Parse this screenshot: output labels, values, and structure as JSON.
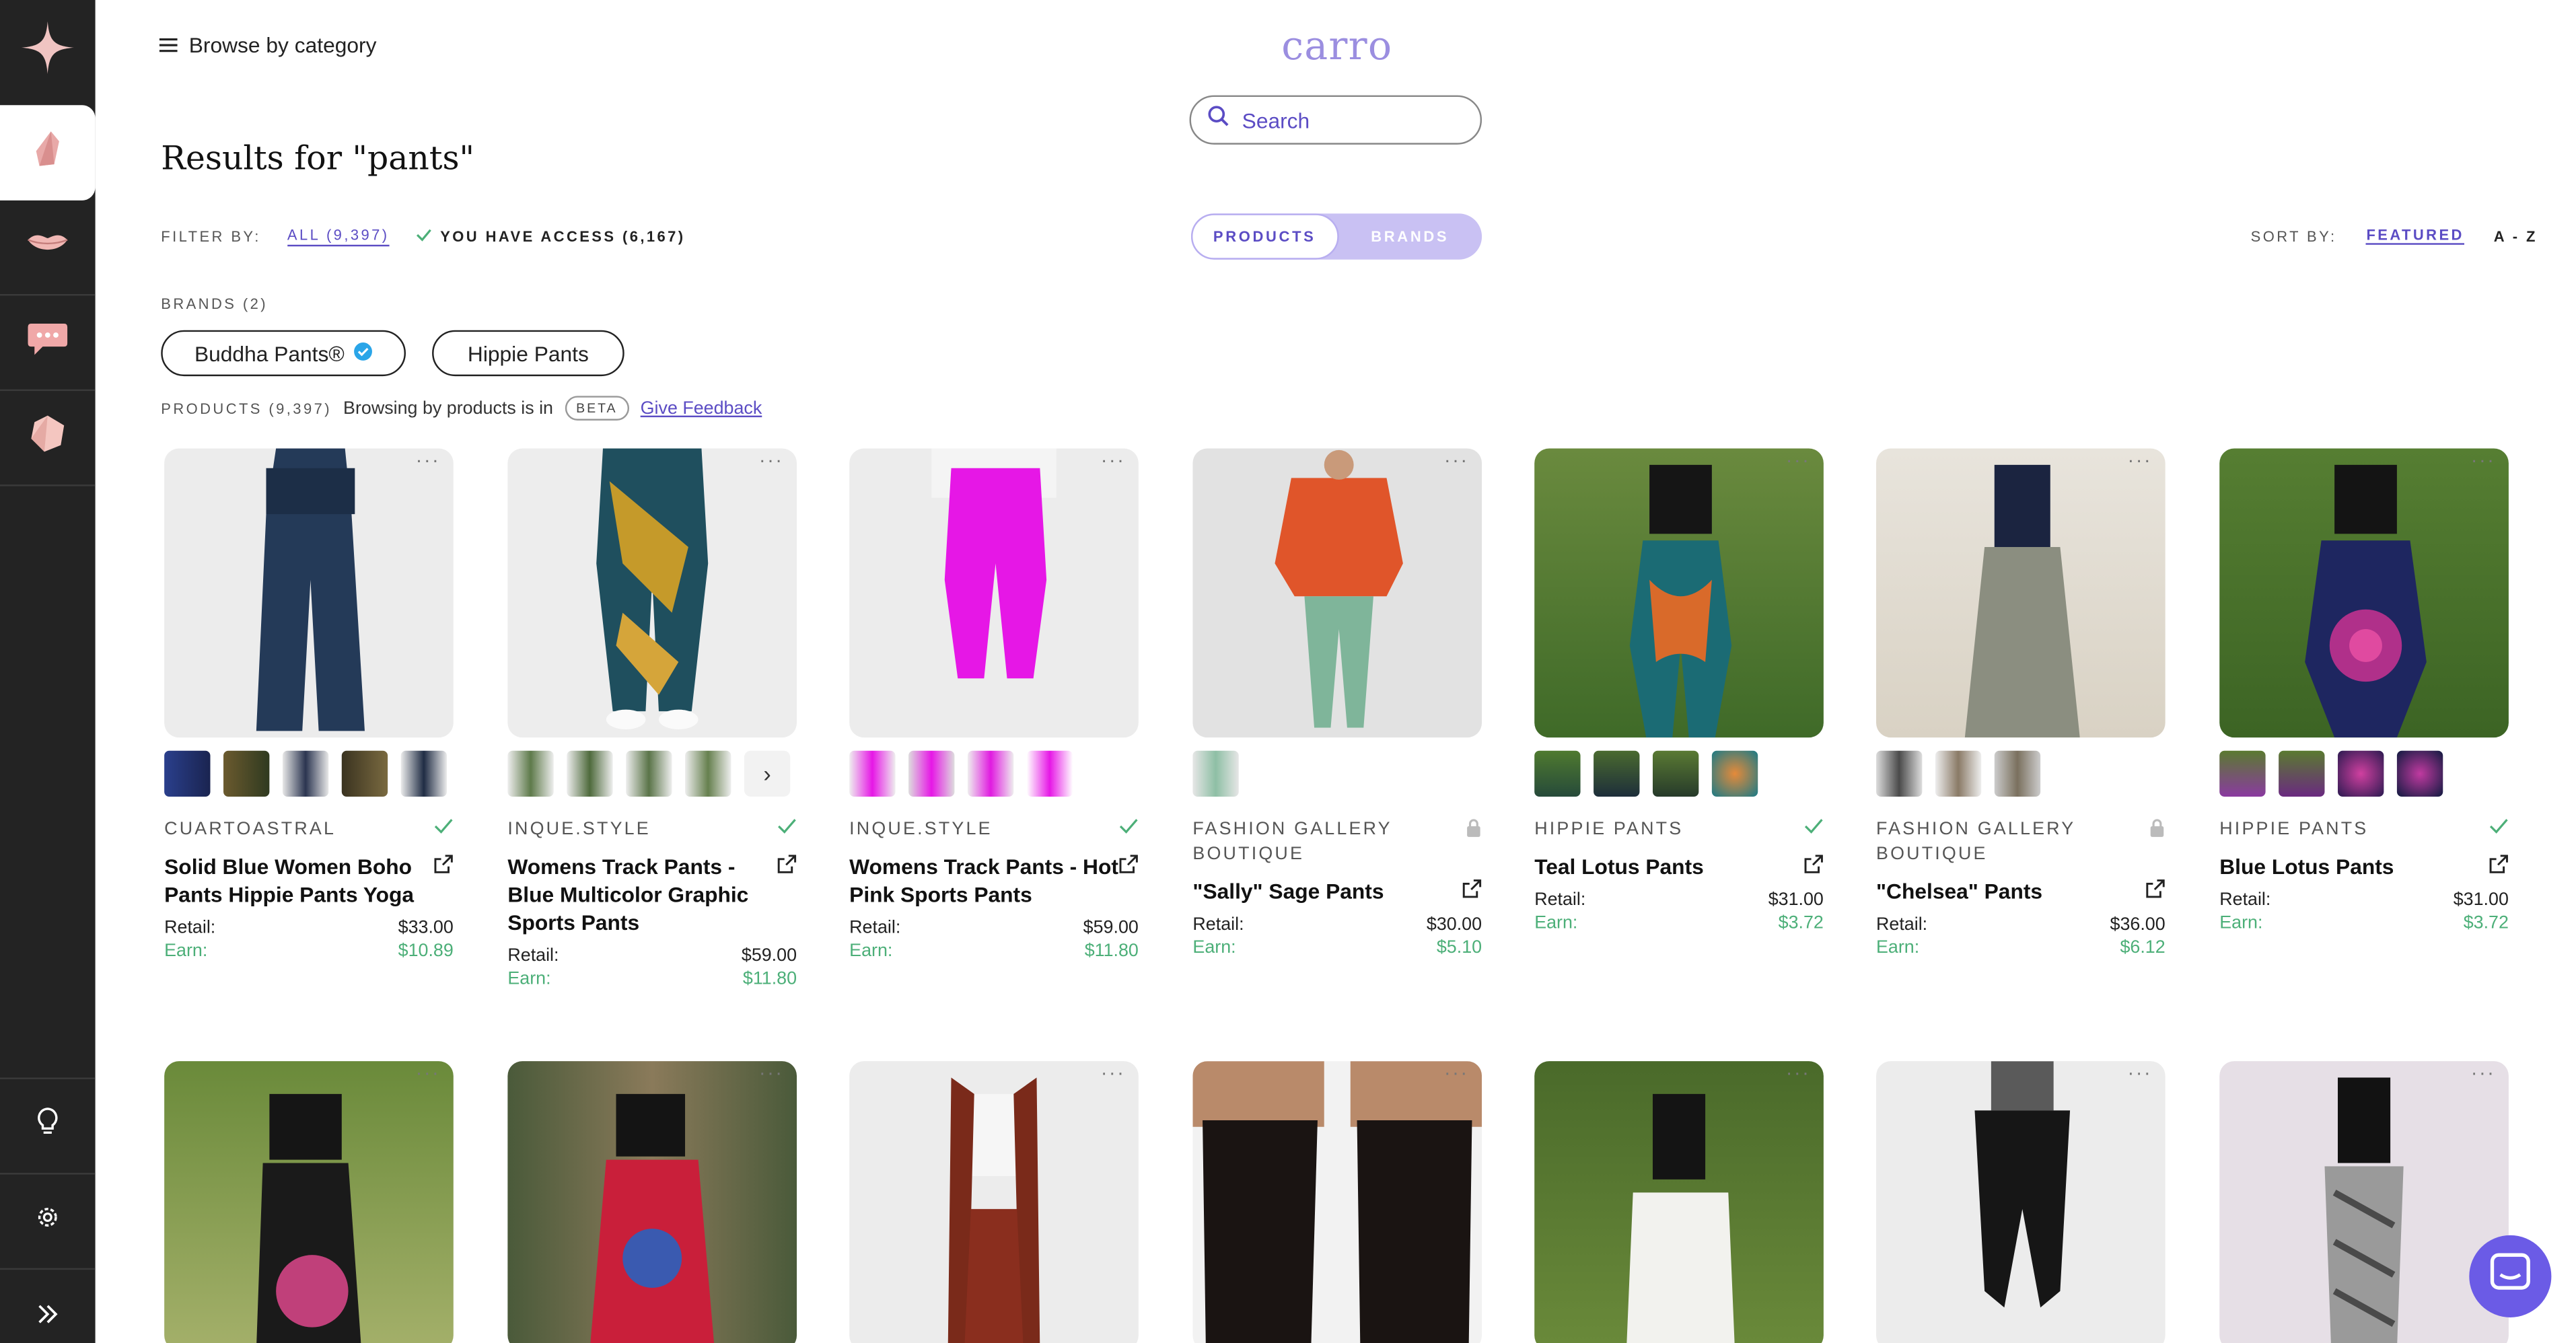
{
  "header": {
    "browse_label": "Browse by category",
    "logo": "carro",
    "search_placeholder": "Search"
  },
  "results": {
    "title": "Results for \"pants\""
  },
  "filter": {
    "label": "FILTER BY:",
    "all": "ALL (9,397)",
    "access": "YOU HAVE ACCESS (6,167)"
  },
  "view_toggle": {
    "products": "PRODUCTS",
    "brands": "BRANDS",
    "active": "PRODUCTS"
  },
  "sort": {
    "label": "SORT BY:",
    "featured": "FEATURED",
    "az": "A - Z"
  },
  "brands": {
    "label": "BRANDS (2)",
    "items": [
      "Buddha Pants®",
      "Hippie Pants"
    ]
  },
  "products_bar": {
    "count": "PRODUCTS (9,397)",
    "text": "Browsing by products is in",
    "badge": "BETA",
    "feedback": "Give Feedback"
  },
  "labels": {
    "retail": "Retail:",
    "earn": "Earn:"
  },
  "products": [
    {
      "brand": "CUARTOASTRAL",
      "title": "Solid Blue Women Boho Pants Hippie Pants Yoga",
      "retail": "$33.00",
      "earn": "$10.89",
      "access": "check"
    },
    {
      "brand": "INQUE.STYLE",
      "title": "Womens Track Pants - Blue Multicolor Graphic Sports Pants",
      "retail": "$59.00",
      "earn": "$11.80",
      "access": "check"
    },
    {
      "brand": "INQUE.STYLE",
      "title": "Womens Track Pants - Hot Pink Sports Pants",
      "retail": "$59.00",
      "earn": "$11.80",
      "access": "check"
    },
    {
      "brand": "FASHION GALLERY BOUTIQUE",
      "title": "\"Sally\" Sage Pants",
      "retail": "$30.00",
      "earn": "$5.10",
      "access": "lock"
    },
    {
      "brand": "HIPPIE PANTS",
      "title": "Teal Lotus Pants",
      "retail": "$31.00",
      "earn": "$3.72",
      "access": "check"
    },
    {
      "brand": "FASHION GALLERY BOUTIQUE",
      "title": "\"Chelsea\" Pants",
      "retail": "$36.00",
      "earn": "$6.12",
      "access": "lock"
    },
    {
      "brand": "HIPPIE PANTS",
      "title": "Blue Lotus Pants",
      "retail": "$31.00",
      "earn": "$3.72",
      "access": "check"
    }
  ],
  "colors": {
    "accent": "#5b4cc4",
    "earn_green": "#4caf78",
    "sidebar_bg": "#232323",
    "chat_button": "#6b5be6"
  },
  "icons": {
    "sidebar": [
      "sparkle-icon",
      "crystal-icon",
      "lips-icon",
      "chat-bubble-icon",
      "gem-icon",
      "lightbulb-icon",
      "gear-icon",
      "double-chevron-right-icon"
    ]
  }
}
